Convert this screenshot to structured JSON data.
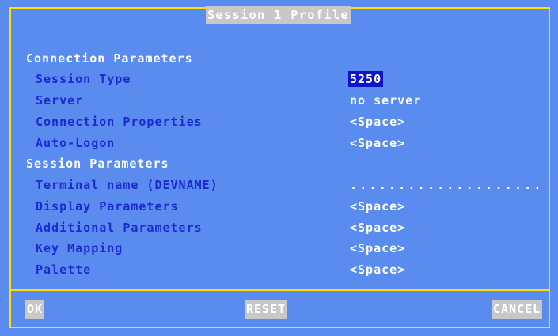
{
  "window": {
    "title": "Session 1 Profile"
  },
  "sections": {
    "connection_header": "Connection Parameters",
    "session_header": "Session Parameters"
  },
  "fields": {
    "session_type": {
      "label": "Session Type",
      "value": "5250"
    },
    "server": {
      "label": "Server",
      "value": "no server"
    },
    "connection_properties": {
      "label": "Connection Properties",
      "value": "<Space>"
    },
    "auto_logon": {
      "label": "Auto-Logon",
      "value": "<Space>"
    },
    "terminal_name": {
      "label": "Terminal name (DEVNAME)",
      "value": "...................."
    },
    "display_parameters": {
      "label": "Display Parameters",
      "value": "<Space>"
    },
    "additional_parameters": {
      "label": "Additional Parameters",
      "value": "<Space>"
    },
    "key_mapping": {
      "label": "Key Mapping",
      "value": "<Space>"
    },
    "palette": {
      "label": "Palette",
      "value": "<Space>"
    }
  },
  "buttons": {
    "ok": "OK",
    "reset": "RESET",
    "cancel": "CANCEL"
  },
  "colors": {
    "background": "#5a8cf0",
    "frame": "#ffe000",
    "label": "#1c2ad0",
    "selection": "#0c14d0",
    "title_bg": "#c8c8c8"
  }
}
